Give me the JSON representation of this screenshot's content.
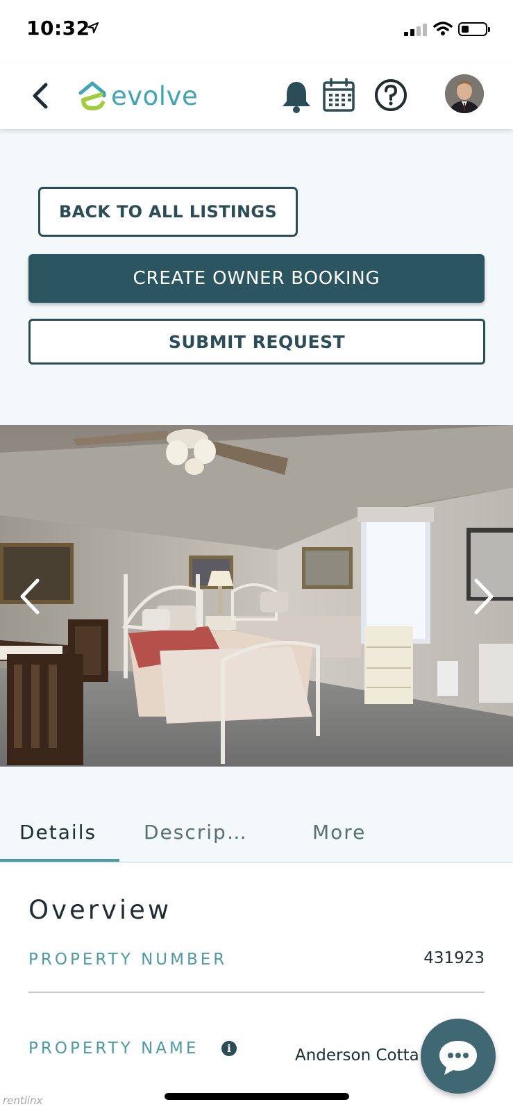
{
  "status_bar": {
    "time": "10:32"
  },
  "header": {
    "logo_text": "evolve",
    "icons": [
      "back-chevron-icon",
      "bell-icon",
      "calendar-icon",
      "help-icon",
      "avatar"
    ]
  },
  "actions": {
    "back_to_listings": "BACK TO ALL LISTINGS",
    "create_owner_booking": "CREATE OWNER BOOKING",
    "submit_request": "SUBMIT REQUEST"
  },
  "tabs": [
    {
      "label": "Details",
      "active": true
    },
    {
      "label": "Descrip…",
      "active": false
    },
    {
      "label": "More",
      "active": false
    }
  ],
  "details": {
    "section_title": "Overview",
    "rows": [
      {
        "label": "PROPERTY NUMBER",
        "value": "431923"
      },
      {
        "label": "PROPERTY NAME",
        "value": "Anderson Cotta"
      }
    ]
  },
  "watermark": "rentlinx",
  "colors": {
    "brand_teal": "#4b9aa6",
    "dark_teal": "#2b5661",
    "logo_green": "#a3cc3a"
  }
}
